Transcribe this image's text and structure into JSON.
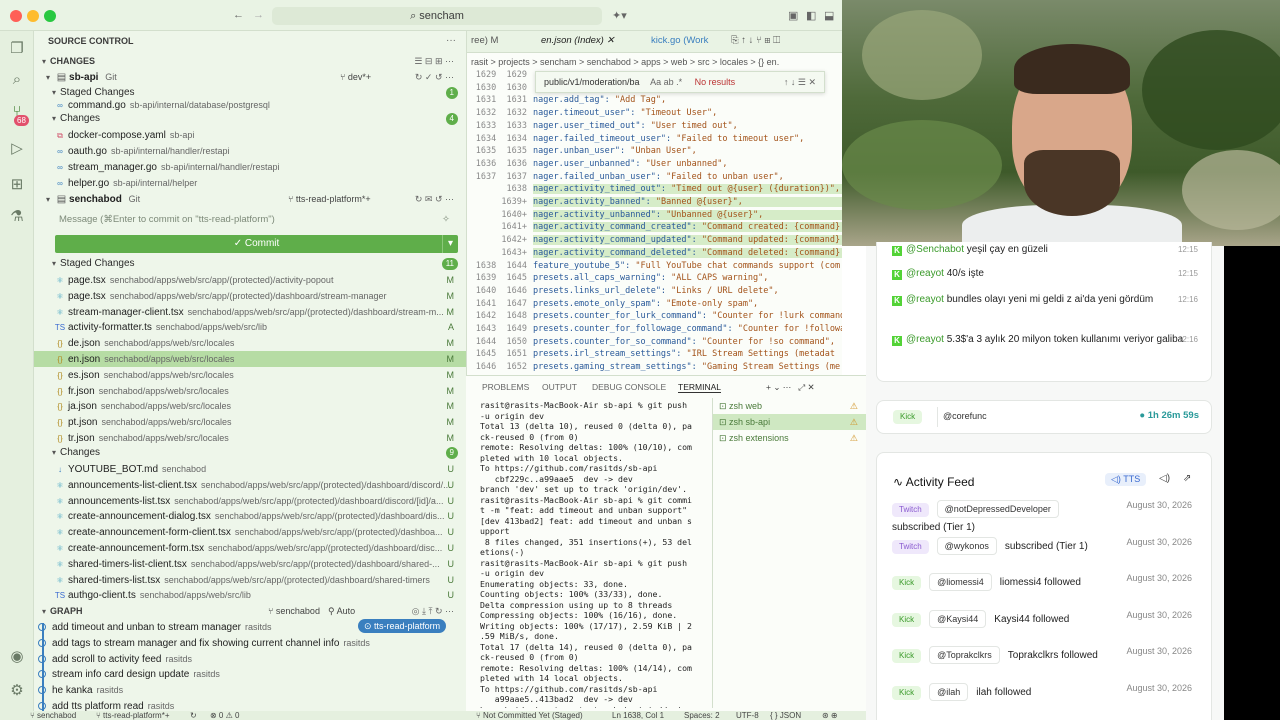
{
  "titlebar": {
    "search": "sencham"
  },
  "scm": {
    "title": "SOURCE CONTROL",
    "changes_header": "CHANGES",
    "repo1": {
      "name": "sb-api",
      "kind": "Git",
      "branch": "dev*+"
    },
    "staged_label": "Staged Changes",
    "staged_count": "1",
    "repo1_staged": [
      {
        "name": "command.go",
        "path": "sb-api/internal/database/postgresql"
      }
    ],
    "changes_label": "Changes",
    "repo1_changes_count": "4",
    "repo1_changes": [
      {
        "name": "docker-compose.yaml",
        "path": "sb-api",
        "icon": "docker-icon"
      },
      {
        "name": "oauth.go",
        "path": "sb-api/internal/handler/restapi"
      },
      {
        "name": "stream_manager.go",
        "path": "sb-api/internal/handler/restapi"
      },
      {
        "name": "helper.go",
        "path": "sb-api/internal/helper"
      }
    ],
    "repo2": {
      "name": "senchabod",
      "kind": "Git",
      "branch": "tts-read-platform*+"
    },
    "message_placeholder": "Message (⌘Enter to commit on \"tts-read-platform\")",
    "commit_label": "✓ Commit",
    "repo2_staged_count": "11",
    "repo2_staged": [
      {
        "name": "page.tsx",
        "path": "senchabod/apps/web/src/app/(protected)/activity-popout",
        "st": "M"
      },
      {
        "name": "page.tsx",
        "path": "senchabod/apps/web/src/app/(protected)/dashboard/stream-manager",
        "st": "M"
      },
      {
        "name": "stream-manager-client.tsx",
        "path": "senchabod/apps/web/src/app/(protected)/dashboard/stream-m...",
        "st": "M"
      },
      {
        "name": "activity-formatter.ts",
        "path": "senchabod/apps/web/src/lib",
        "st": "A"
      },
      {
        "name": "de.json",
        "path": "senchabod/apps/web/src/locales",
        "st": "M"
      },
      {
        "name": "en.json",
        "path": "senchabod/apps/web/src/locales",
        "st": "M"
      },
      {
        "name": "es.json",
        "path": "senchabod/apps/web/src/locales",
        "st": "M"
      },
      {
        "name": "fr.json",
        "path": "senchabod/apps/web/src/locales",
        "st": "M"
      },
      {
        "name": "ja.json",
        "path": "senchabod/apps/web/src/locales",
        "st": "M"
      },
      {
        "name": "pt.json",
        "path": "senchabod/apps/web/src/locales",
        "st": "M"
      },
      {
        "name": "tr.json",
        "path": "senchabod/apps/web/src/locales",
        "st": "M"
      }
    ],
    "repo2_changes_count": "9",
    "repo2_changes": [
      {
        "name": "YOUTUBE_BOT.md",
        "path": "senchabod",
        "st": "U"
      },
      {
        "name": "announcements-list-client.tsx",
        "path": "senchabod/apps/web/src/app/(protected)/dashboard/discord/...",
        "st": "U"
      },
      {
        "name": "announcements-list.tsx",
        "path": "senchabod/apps/web/src/app/(protected)/dashboard/discord/[id]/a...",
        "st": "U"
      },
      {
        "name": "create-announcement-dialog.tsx",
        "path": "senchabod/apps/web/src/app/(protected)/dashboard/dis...",
        "st": "U"
      },
      {
        "name": "create-announcement-form-client.tsx",
        "path": "senchabod/apps/web/src/app/(protected)/dashboa...",
        "st": "U"
      },
      {
        "name": "create-announcement-form.tsx",
        "path": "senchabod/apps/web/src/app/(protected)/dashboard/disc...",
        "st": "U"
      },
      {
        "name": "shared-timers-list-client.tsx",
        "path": "senchabod/apps/web/src/app/(protected)/dashboard/shared-...",
        "st": "U"
      },
      {
        "name": "shared-timers-list.tsx",
        "path": "senchabod/apps/web/src/app/(protected)/dashboard/shared-timers",
        "st": "U"
      },
      {
        "name": "authgo-client.ts",
        "path": "senchabod/apps/web/src/lib",
        "st": "U"
      }
    ],
    "graph_label": "GRAPH",
    "graph_repo": "senchabod",
    "graph_auto": "Auto",
    "graph_branch": "tts-read-platform",
    "commits": [
      {
        "msg": "add timeout and unban to stream manager",
        "author": "rasitds"
      },
      {
        "msg": "add tags to stream manager and fix showing current channel info",
        "author": "rasitds"
      },
      {
        "msg": "add scroll to activity feed",
        "author": "rasitds"
      },
      {
        "msg": "stream info card design update",
        "author": "rasitds"
      },
      {
        "msg": "he kanka",
        "author": "rasitds"
      },
      {
        "msg": "add tts platform read",
        "author": "rasitds"
      }
    ]
  },
  "editor": {
    "tabs": [
      "ree) M",
      "en.json (Index)",
      "kick.go (Work"
    ],
    "crumbs": "rasit > projects > sencham > senchabod > apps > web > src > locales > {} en.",
    "find_value": "public/v1/moderation/ba",
    "find_result": "No results",
    "lines": [
      {
        "l": "1629",
        "r": "1629",
        "k": "",
        "v": ""
      },
      {
        "l": "1630",
        "r": "1630",
        "k": "",
        "v": ""
      },
      {
        "l": "1631",
        "r": "1631",
        "k": "nager.add_tag\": ",
        "v": "\"Add Tag\","
      },
      {
        "l": "1632",
        "r": "1632",
        "k": "nager.timeout_user\": ",
        "v": "\"Timeout User\","
      },
      {
        "l": "1633",
        "r": "1633",
        "k": "nager.user_timed_out\": ",
        "v": "\"User timed out\","
      },
      {
        "l": "1634",
        "r": "1634",
        "k": "nager.failed_timeout_user\": ",
        "v": "\"Failed to timeout user\","
      },
      {
        "l": "1635",
        "r": "1635",
        "k": "nager.unban_user\": ",
        "v": "\"Unban User\","
      },
      {
        "l": "1636",
        "r": "1636",
        "k": "nager.user_unbanned\": ",
        "v": "\"User unbanned\","
      },
      {
        "l": "1637",
        "r": "1637",
        "k": "nager.failed_unban_user\": ",
        "v": "\"Failed to unban user\","
      },
      {
        "l": "",
        "r": "1638",
        "k": "nager.activity_timed_out\": ",
        "v": "\"Timed out @{user} ({duration})\",",
        "add": true
      },
      {
        "l": "",
        "r": "1639+",
        "k": "nager.activity_banned\": ",
        "v": "\"Banned @{user}\",",
        "add": true
      },
      {
        "l": "",
        "r": "1640+",
        "k": "nager.activity_unbanned\": ",
        "v": "\"Unbanned @{user}\",",
        "add": true
      },
      {
        "l": "",
        "r": "1641+",
        "k": "nager.activity_command_created\": ",
        "v": "\"Command created: {command}",
        "add": true
      },
      {
        "l": "",
        "r": "1642+",
        "k": "nager.activity_command_updated\": ",
        "v": "\"Command updated: {command}",
        "add": true
      },
      {
        "l": "",
        "r": "1643+",
        "k": "nager.activity_command_deleted\": ",
        "v": "\"Command deleted: {command}",
        "add": true
      },
      {
        "l": "1638",
        "r": "1644",
        "k": "feature_youtube_5\": ",
        "v": "\"Full YouTube chat commands support (com"
      },
      {
        "l": "1639",
        "r": "1645",
        "k": "presets.all_caps_warning\": ",
        "v": "\"ALL CAPS warning\","
      },
      {
        "l": "1640",
        "r": "1646",
        "k": "presets.links_url_delete\": ",
        "v": "\"Links / URL delete\","
      },
      {
        "l": "1641",
        "r": "1647",
        "k": "presets.emote_only_spam\": ",
        "v": "\"Emote-only spam\","
      },
      {
        "l": "1642",
        "r": "1648",
        "k": "presets.counter_for_lurk_command\": ",
        "v": "\"Counter for !lurk command"
      },
      {
        "l": "1643",
        "r": "1649",
        "k": "presets.counter_for_followage_command\": ",
        "v": "\"Counter for !followa"
      },
      {
        "l": "1644",
        "r": "1650",
        "k": "presets.counter_for_so_command\": ",
        "v": "\"Counter for !so command\","
      },
      {
        "l": "1645",
        "r": "1651",
        "k": "presets.irl_stream_settings\": ",
        "v": "\"IRL Stream Settings (metadat"
      },
      {
        "l": "1646",
        "r": "1652",
        "k": "presets.gaming_stream_settings\": ",
        "v": "\"Gaming Stream Settings (me"
      }
    ]
  },
  "panel": {
    "tabs": [
      "PROBLEMS",
      "OUTPUT",
      "DEBUG CONSOLE",
      "TERMINAL"
    ],
    "terminal": "rasit@rasits-MacBook-Air sb-api % git push\n-u origin dev\nTotal 13 (delta 10), reused 0 (delta 0), pa\nck-reused 0 (from 0)\nremote: Resolving deltas: 100% (10/10), com\npleted with 10 local objects.\nTo https://github.com/rasitds/sb-api\n   cbf229c..a99aae5  dev -> dev\nbranch 'dev' set up to track 'origin/dev'.\nrasit@rasits-MacBook-Air sb-api % git commi\nt -m \"feat: add timeout and unban support\"\n[dev 413bad2] feat: add timeout and unban s\nupport\n 8 files changed, 351 insertions(+), 53 del\netions(-)\nrasit@rasits-MacBook-Air sb-api % git push\n-u origin dev\nEnumerating objects: 33, done.\nCounting objects: 100% (33/33), done.\nDelta compression using up to 8 threads\nCompressing objects: 100% (16/16), done.\nWriting objects: 100% (17/17), 2.59 KiB | 2\n.59 MiB/s, done.\nTotal 17 (delta 14), reused 0 (delta 0), pa\nck-reused 0 (from 0)\nremote: Resolving deltas: 100% (14/14), com\npleted with 14 local objects.\nTo https://github.com/rasitds/sb-api\n   a99aae5..413bad2  dev -> dev\nbranch 'dev' set up to track 'origin/dev'.\nrasit@rasits-MacBook-Air sb-api %",
    "terminals": [
      "zsh web",
      "zsh sb-api",
      "zsh extensions"
    ]
  },
  "statusbar": {
    "branch": "senchabod",
    "branch2": "tts-read-platform*+",
    "errors": "⊗ 0 ⚠ 0",
    "commit_state": "Not Committed Yet (Staged)",
    "pos": "Ln 1638, Col 1",
    "spaces": "Spaces: 2",
    "enc": "UTF-8",
    "lang": "JSON"
  },
  "dashboard": {
    "chat": [
      {
        "user": "@Senchabot",
        "text": "yeşil çay en güzeli",
        "time": "12:15"
      },
      {
        "user": "@reayot",
        "text": "40/s işte",
        "time": "12:15"
      },
      {
        "user": "@reayot",
        "text": "bundles olayı yeni mi geldi z ai'da yeni gördüm",
        "time": "12:16"
      },
      {
        "user": "@reayot",
        "text": "5.3$'a 3 aylık 20 milyon token kullanımı veriyor galiba",
        "time": "12:16"
      }
    ],
    "stream_platform": "Kick",
    "stream_user": "@corefunc",
    "stream_uptime": "1h 26m 59s",
    "feed_title": "Activity Feed",
    "tts_label": "TTS",
    "events": [
      {
        "platform": "Twitch",
        "user": "@notDepressedDeveloper",
        "text": "subscribed (Tier 1)",
        "date": "August 30, 2026"
      },
      {
        "platform": "Twitch",
        "user": "@wykonos",
        "text": "subscribed (Tier 1)",
        "date": "August 30, 2026"
      },
      {
        "platform": "Kick",
        "user": "@liomessi4",
        "text": "liomessi4 followed",
        "date": "August 30, 2026"
      },
      {
        "platform": "Kick",
        "user": "@Kaysi44",
        "text": "Kaysi44 followed",
        "date": "August 30, 2026"
      },
      {
        "platform": "Kick",
        "user": "@Toprakclkrs",
        "text": "Toprakclkrs followed",
        "date": "August 30, 2026"
      },
      {
        "platform": "Kick",
        "user": "@ilah",
        "text": "ilah followed",
        "date": "August 30, 2026"
      }
    ]
  }
}
